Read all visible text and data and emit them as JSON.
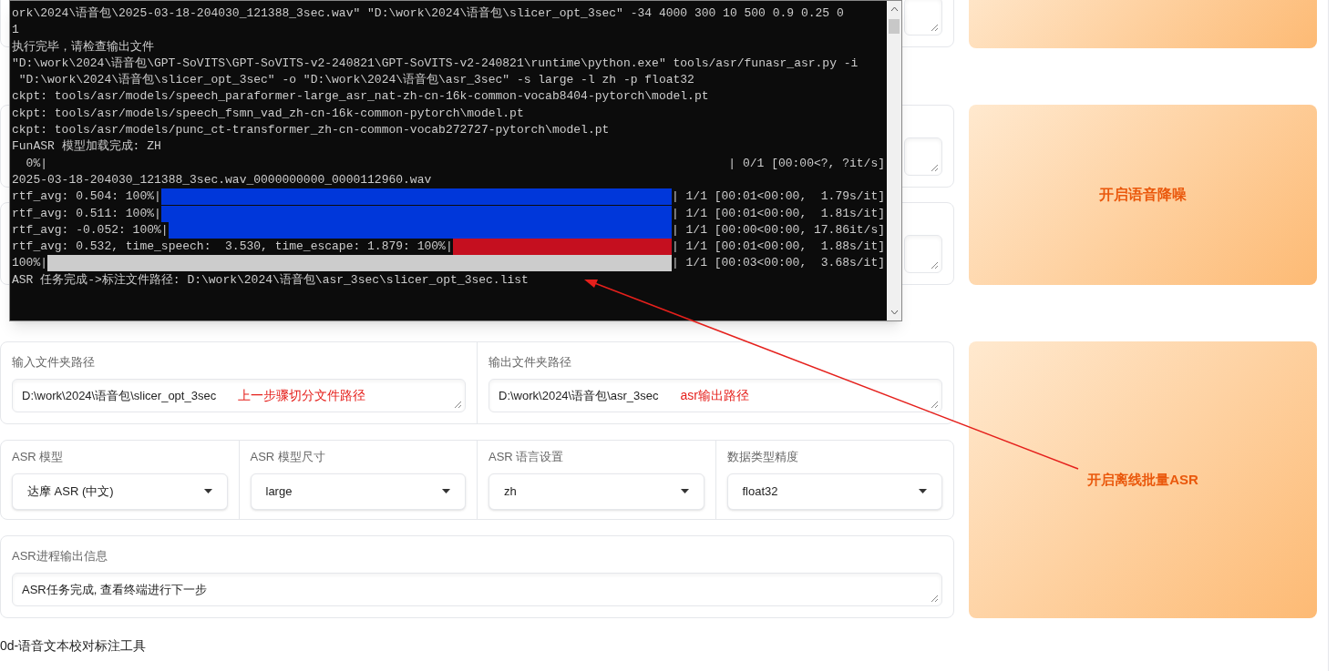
{
  "terminal": {
    "lines": [
      {
        "kind": "text",
        "text": "ork\\2024\\语音包\\2025-03-18-204030_121388_3sec.wav\" \"D:\\work\\2024\\语音包\\slicer_opt_3sec\" -34 4000 300 10 500 0.9 0.25 0"
      },
      {
        "kind": "text",
        "text": "1"
      },
      {
        "kind": "text",
        "text": "执行完毕，请检查输出文件"
      },
      {
        "kind": "text",
        "text": "\"D:\\work\\2024\\语音包\\GPT-SoVITS\\GPT-SoVITS-v2-240821\\GPT-SoVITS-v2-240821\\runtime\\python.exe\" tools/asr/funasr_asr.py -i"
      },
      {
        "kind": "text",
        "text": " \"D:\\work\\2024\\语音包\\slicer_opt_3sec\" -o \"D:\\work\\2024\\语音包\\asr_3sec\" -s large -l zh -p float32"
      },
      {
        "kind": "text",
        "text": "ckpt: tools/asr/models/speech_paraformer-large_asr_nat-zh-cn-16k-common-vocab8404-pytorch\\model.pt"
      },
      {
        "kind": "text",
        "text": "ckpt: tools/asr/models/speech_fsmn_vad_zh-cn-16k-common-pytorch\\model.pt"
      },
      {
        "kind": "text",
        "text": "ckpt: tools/asr/models/punc_ct-transformer_zh-cn-common-vocab272727-pytorch\\model.pt"
      },
      {
        "kind": "text",
        "text": "FunASR 模型加载完成: ZH"
      },
      {
        "kind": "progress_empty",
        "prefix": "  0%|",
        "suffix": "| 0/1 [00:00<?, ?it/s]"
      },
      {
        "kind": "text",
        "text": "2025-03-18-204030_121388_3sec.wav_0000000000_0000112960.wav"
      },
      {
        "kind": "progress",
        "prefix": "rtf_avg: 0.504: 100%|",
        "color": "#0037da",
        "suffix": "| 1/1 [00:01<00:00,  1.79s/it]"
      },
      {
        "kind": "progress",
        "prefix": "rtf_avg: 0.511: 100%|",
        "color": "#0037da",
        "suffix": "| 1/1 [00:01<00:00,  1.81s/it]"
      },
      {
        "kind": "progress",
        "prefix": "rtf_avg: -0.052: 100%|",
        "color": "#0037da",
        "suffix": "| 1/1 [00:00<00:00, 17.86it/s]"
      },
      {
        "kind": "progress",
        "prefix": "rtf_avg: 0.532, time_speech:  3.530, time_escape: 1.879: 100%|",
        "color": "#c50f1f",
        "suffix": "| 1/1 [00:01<00:00,  1.88s/it]"
      },
      {
        "kind": "progress",
        "prefix": "100%|",
        "color": "#cccccc",
        "suffix": "| 1/1 [00:03<00:00,  3.68s/it]"
      },
      {
        "kind": "text",
        "text": "ASR 任务完成->标注文件路径: D:\\work\\2024\\语音包\\asr_3sec\\slicer_opt_3sec.list"
      }
    ]
  },
  "denoise_button": {
    "label": "开启语音降噪"
  },
  "asr": {
    "input_path": {
      "label": "输入文件夹路径",
      "value": "D:\\work\\2024\\语音包\\slicer_opt_3sec",
      "note": "上一步骤切分文件路径"
    },
    "output_path": {
      "label": "输出文件夹路径",
      "value": "D:\\work\\2024\\语音包\\asr_3sec",
      "note": "asr输出路径"
    },
    "dropdowns": [
      {
        "label": "ASR 模型",
        "value": "达摩 ASR (中文)"
      },
      {
        "label": "ASR 模型尺寸",
        "value": "large"
      },
      {
        "label": "ASR 语言设置",
        "value": "zh"
      },
      {
        "label": "数据类型精度",
        "value": "float32"
      }
    ],
    "info": {
      "label": "ASR进程输出信息",
      "value": "ASR任务完成, 查看终端进行下一步"
    },
    "button": {
      "label": "开启离线批量ASR"
    }
  },
  "next_section": {
    "title": "0d-语音文本校对标注工具"
  }
}
